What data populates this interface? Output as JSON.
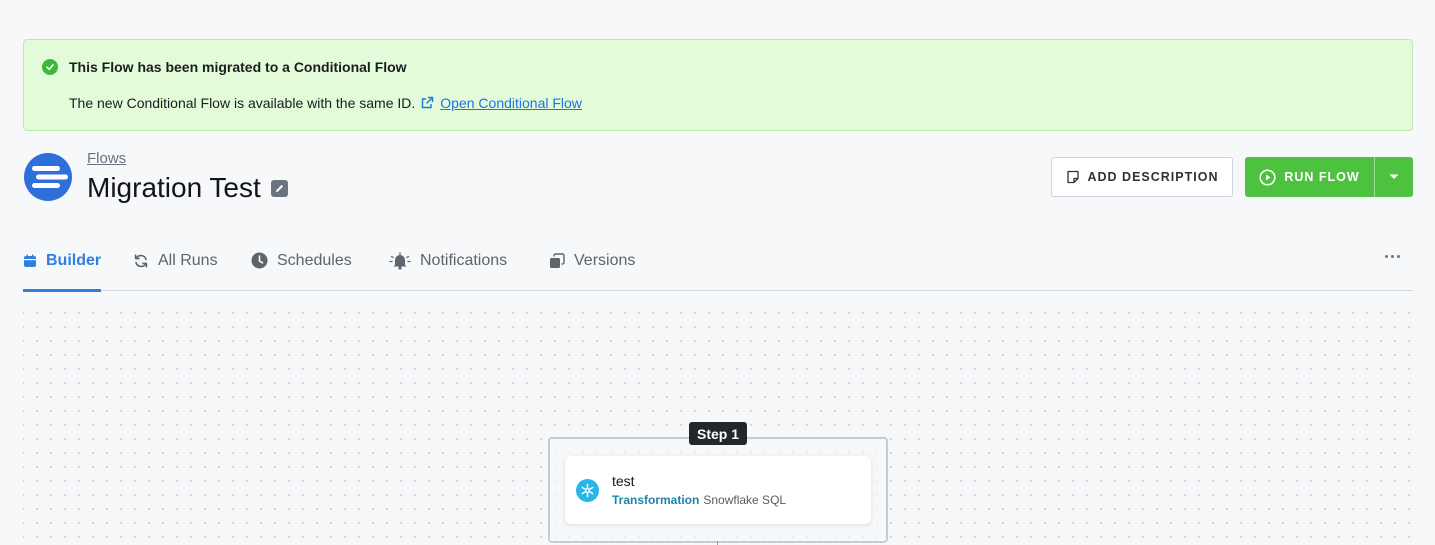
{
  "banner": {
    "title": "This Flow has been migrated to a Conditional Flow",
    "body": "The new Conditional Flow is available with the same ID.",
    "link_label": "Open Conditional Flow",
    "icon": "check-circle-icon",
    "color": "#e3fbd9"
  },
  "header": {
    "breadcrumb": "Flows",
    "title": "Migration Test",
    "add_description_label": "ADD DESCRIPTION",
    "run_flow_label": "RUN FLOW",
    "accent": "#4cc23f"
  },
  "tabs": [
    {
      "label": "Builder",
      "icon": "calendar-icon",
      "active": true
    },
    {
      "label": "All Runs",
      "icon": "refresh-icon",
      "active": false
    },
    {
      "label": "Schedules",
      "icon": "clock-icon",
      "active": false
    },
    {
      "label": "Notifications",
      "icon": "bell-icon",
      "active": false
    },
    {
      "label": "Versions",
      "icon": "copy-icon",
      "active": false
    }
  ],
  "builder": {
    "step_label": "Step 1",
    "node": {
      "title": "test",
      "type": "Transformation",
      "component": "Snowflake SQL",
      "icon": "snowflake-icon"
    }
  }
}
